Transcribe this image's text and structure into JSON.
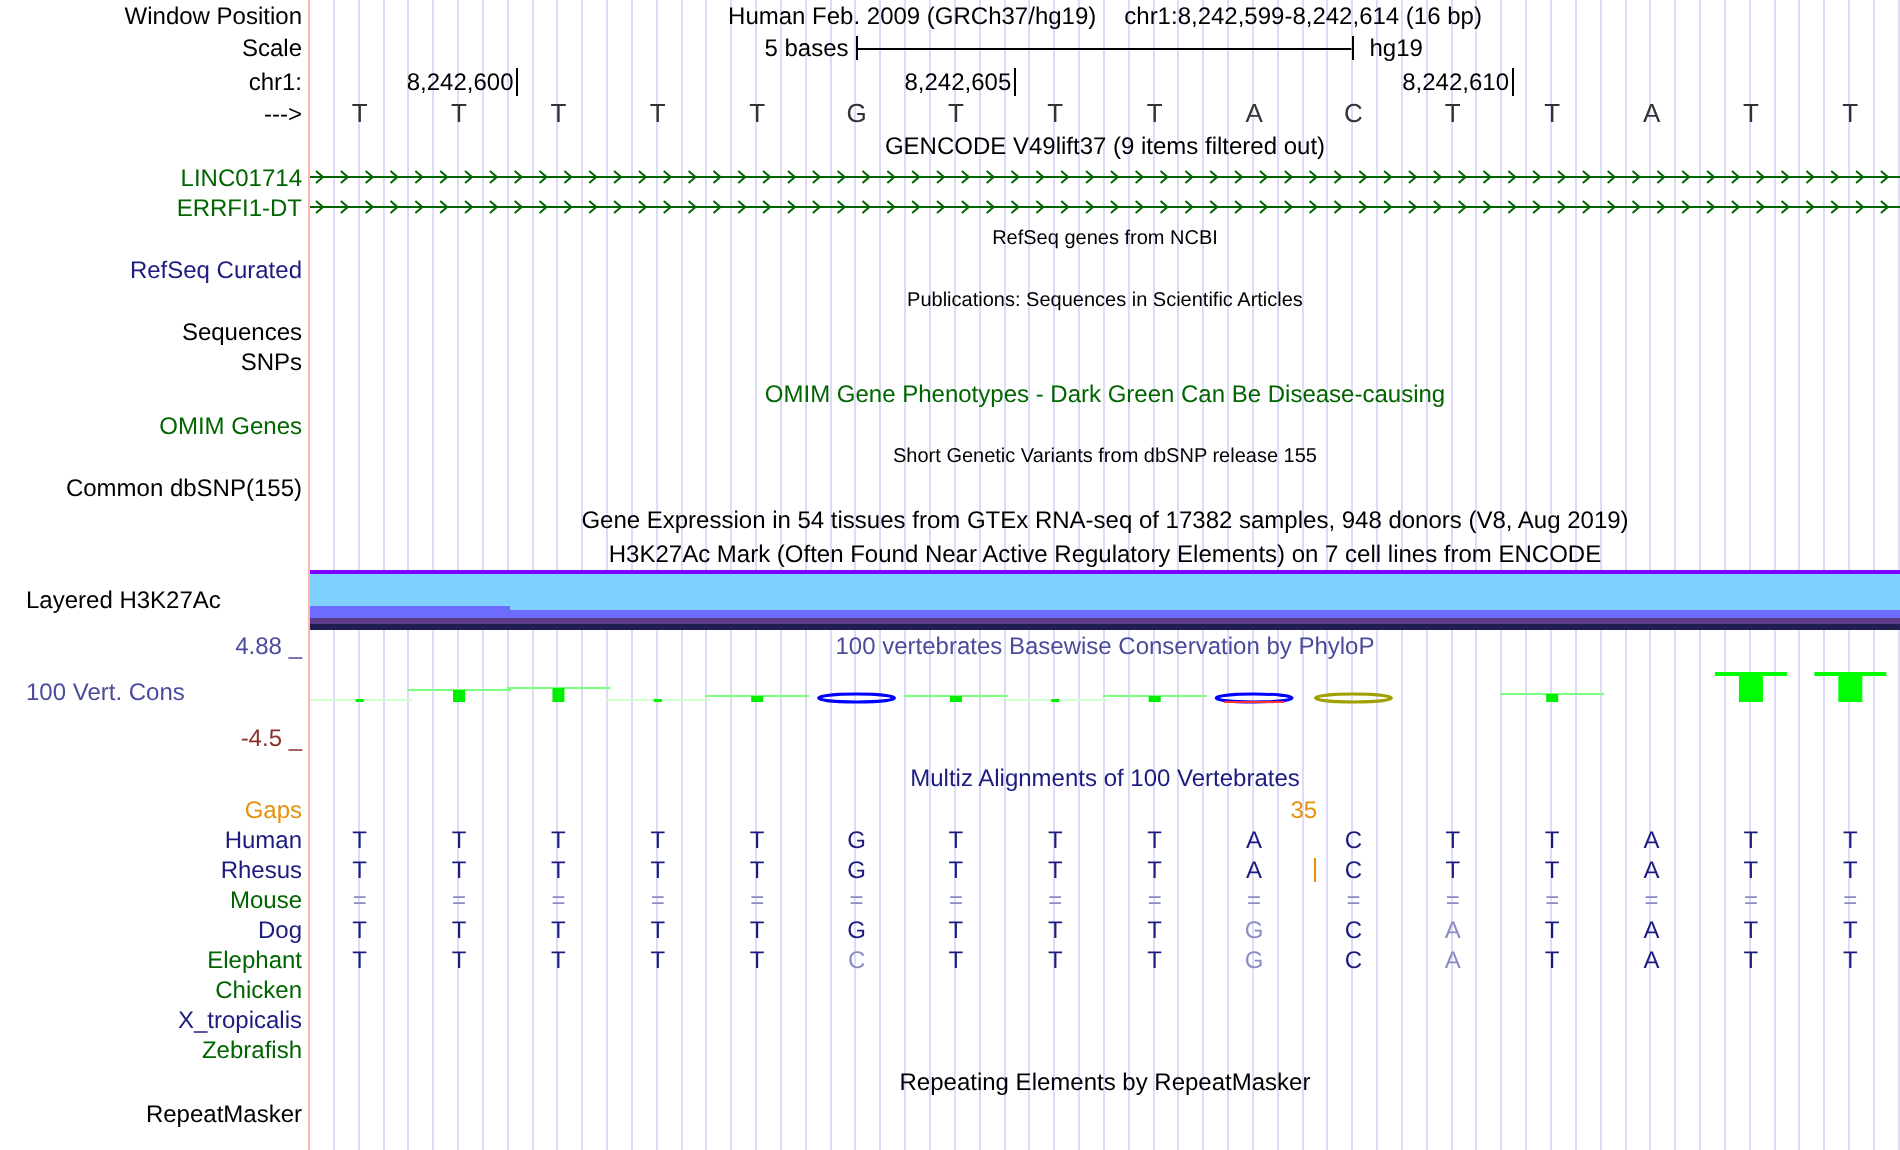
{
  "header": {
    "label": "Window Position",
    "assembly": "Human Feb. 2009 (GRCh37/hg19)",
    "position": "chr1:8,242,599-8,242,614 (16 bp)"
  },
  "scale": {
    "label": "Scale",
    "text": "5 bases",
    "db": "hg19"
  },
  "ruler": {
    "chrom_label": "chr1:",
    "strand_label": "--->",
    "bases": [
      {
        "base": "T"
      },
      {
        "base": "T",
        "tick": "8,242,600"
      },
      {
        "base": "T"
      },
      {
        "base": "T"
      },
      {
        "base": "T"
      },
      {
        "base": "G"
      },
      {
        "base": "T",
        "tick": "8,242,605"
      },
      {
        "base": "T"
      },
      {
        "base": "T"
      },
      {
        "base": "A"
      },
      {
        "base": "C"
      },
      {
        "base": "T",
        "tick": "8,242,610"
      },
      {
        "base": "T"
      },
      {
        "base": "A"
      },
      {
        "base": "T"
      },
      {
        "base": "T"
      }
    ]
  },
  "tracks": [
    {
      "kind": "title",
      "text": "GENCODE V49lift37 (9 items filtered out)",
      "color": "#000000"
    },
    {
      "kind": "gene",
      "label": "LINC01714",
      "color": "#006400"
    },
    {
      "kind": "gene",
      "label": "ERRFI1-DT",
      "color": "#006400"
    },
    {
      "kind": "note",
      "text": "RefSeq genes from NCBI",
      "color": "#000000"
    },
    {
      "kind": "label",
      "label": "RefSeq Curated",
      "color": "#1c1c80"
    },
    {
      "kind": "note",
      "text": "Publications: Sequences in Scientific Articles",
      "color": "#000000"
    },
    {
      "kind": "label",
      "label": "Sequences",
      "color": "#000000"
    },
    {
      "kind": "label",
      "label": "SNPs",
      "color": "#000000"
    },
    {
      "kind": "title",
      "text": "OMIM Gene Phenotypes - Dark Green Can Be Disease-causing",
      "color": "#006400"
    },
    {
      "kind": "label",
      "label": "OMIM Genes",
      "color": "#006400"
    },
    {
      "kind": "note",
      "text": "Short Genetic Variants from dbSNP release 155",
      "color": "#000000"
    },
    {
      "kind": "label",
      "label": "Common dbSNP(155)",
      "color": "#000000"
    },
    {
      "kind": "title",
      "text": "Gene Expression in 54 tissues from GTEx RNA-seq of 17382 samples, 948 donors (V8, Aug 2019)",
      "color": "#000000"
    },
    {
      "kind": "title",
      "text": "H3K27Ac Mark (Often Found Near Active Regulatory Elements) on 7 cell lines from ENCODE",
      "color": "#000000"
    },
    {
      "kind": "layered",
      "label": "Layered H3K27Ac",
      "color": "#000000"
    },
    {
      "kind": "phylop",
      "label": "100 Vert. Cons",
      "color": "#4b4b9b",
      "text": "100 vertebrates Basewise Conservation by PhyloP",
      "max": "4.88 _",
      "min": "-4.5 _"
    },
    {
      "kind": "title",
      "text": "Multiz Alignments of 100 Vertebrates",
      "color": "#1c1c80"
    },
    {
      "kind": "gaps",
      "label": "Gaps",
      "color": "#e8900c",
      "count": "35"
    },
    {
      "kind": "species",
      "label": "Human",
      "color": "#1c1c80",
      "bases": [
        {
          "b": "T",
          "faded": false
        },
        {
          "b": "T",
          "faded": false
        },
        {
          "b": "T",
          "faded": false
        },
        {
          "b": "T",
          "faded": false
        },
        {
          "b": "T",
          "faded": false
        },
        {
          "b": "G",
          "faded": false
        },
        {
          "b": "T",
          "faded": false
        },
        {
          "b": "T",
          "faded": false
        },
        {
          "b": "T",
          "faded": false
        },
        {
          "b": "A",
          "faded": false
        },
        {
          "b": "C",
          "faded": false
        },
        {
          "b": "T",
          "faded": false
        },
        {
          "b": "T",
          "faded": false
        },
        {
          "b": "A",
          "faded": false
        },
        {
          "b": "T",
          "faded": false
        },
        {
          "b": "T",
          "faded": false
        }
      ]
    },
    {
      "kind": "species",
      "label": "Rhesus",
      "color": "#1c1c80",
      "bases": [
        {
          "b": "T",
          "faded": false,
          "insertion_after": false
        },
        {
          "b": "T",
          "faded": false,
          "insertion_after": false
        },
        {
          "b": "T",
          "faded": false,
          "insertion_after": false
        },
        {
          "b": "T",
          "faded": false,
          "insertion_after": false
        },
        {
          "b": "T",
          "faded": false,
          "insertion_after": false
        },
        {
          "b": "G",
          "faded": false,
          "insertion_after": false
        },
        {
          "b": "T",
          "faded": false,
          "insertion_after": false
        },
        {
          "b": "T",
          "faded": false,
          "insertion_after": false
        },
        {
          "b": "T",
          "faded": false,
          "insertion_after": false
        },
        {
          "b": "A",
          "faded": false,
          "insertion_after": true
        },
        {
          "b": "C",
          "faded": false,
          "insertion_after": false
        },
        {
          "b": "T",
          "faded": false,
          "insertion_after": false
        },
        {
          "b": "T",
          "faded": false,
          "insertion_after": false
        },
        {
          "b": "A",
          "faded": false,
          "insertion_after": false
        },
        {
          "b": "T",
          "faded": false,
          "insertion_after": false
        },
        {
          "b": "T",
          "faded": false,
          "insertion_after": false
        }
      ]
    },
    {
      "kind": "species",
      "label": "Mouse",
      "color": "#006400",
      "bases": [
        {
          "b": "=",
          "faded": true
        },
        {
          "b": "=",
          "faded": true
        },
        {
          "b": "=",
          "faded": true
        },
        {
          "b": "=",
          "faded": true
        },
        {
          "b": "=",
          "faded": true
        },
        {
          "b": "=",
          "faded": true
        },
        {
          "b": "=",
          "faded": true
        },
        {
          "b": "=",
          "faded": true
        },
        {
          "b": "=",
          "faded": true
        },
        {
          "b": "=",
          "faded": true
        },
        {
          "b": "=",
          "faded": true
        },
        {
          "b": "=",
          "faded": true
        },
        {
          "b": "=",
          "faded": true
        },
        {
          "b": "=",
          "faded": true
        },
        {
          "b": "=",
          "faded": true
        },
        {
          "b": "=",
          "faded": true
        }
      ]
    },
    {
      "kind": "species",
      "label": "Dog",
      "color": "#1c1c80",
      "bases": [
        {
          "b": "T",
          "faded": false
        },
        {
          "b": "T",
          "faded": false
        },
        {
          "b": "T",
          "faded": false
        },
        {
          "b": "T",
          "faded": false
        },
        {
          "b": "T",
          "faded": false
        },
        {
          "b": "G",
          "faded": false
        },
        {
          "b": "T",
          "faded": false
        },
        {
          "b": "T",
          "faded": false
        },
        {
          "b": "T",
          "faded": false
        },
        {
          "b": "G",
          "faded": true
        },
        {
          "b": "C",
          "faded": false
        },
        {
          "b": "A",
          "faded": true
        },
        {
          "b": "T",
          "faded": false
        },
        {
          "b": "A",
          "faded": false
        },
        {
          "b": "T",
          "faded": false
        },
        {
          "b": "T",
          "faded": false
        }
      ]
    },
    {
      "kind": "species",
      "label": "Elephant",
      "color": "#006400",
      "bases": [
        {
          "b": "T",
          "faded": false
        },
        {
          "b": "T",
          "faded": false
        },
        {
          "b": "T",
          "faded": false
        },
        {
          "b": "T",
          "faded": false
        },
        {
          "b": "T",
          "faded": false
        },
        {
          "b": "C",
          "faded": true
        },
        {
          "b": "T",
          "faded": false
        },
        {
          "b": "T",
          "faded": false
        },
        {
          "b": "T",
          "faded": false
        },
        {
          "b": "G",
          "faded": true
        },
        {
          "b": "C",
          "faded": false
        },
        {
          "b": "A",
          "faded": true
        },
        {
          "b": "T",
          "faded": false
        },
        {
          "b": "A",
          "faded": false
        },
        {
          "b": "T",
          "faded": false
        },
        {
          "b": "T",
          "faded": false
        }
      ]
    },
    {
      "kind": "species",
      "label": "Chicken",
      "color": "#006400"
    },
    {
      "kind": "species",
      "label": "X_tropicalis",
      "color": "#1c1c80"
    },
    {
      "kind": "species",
      "label": "Zebrafish",
      "color": "#006400"
    },
    {
      "kind": "title",
      "text": "Repeating Elements by RepeatMasker",
      "color": "#000000"
    },
    {
      "kind": "label",
      "label": "RepeatMasker",
      "color": "#000000"
    }
  ]
}
